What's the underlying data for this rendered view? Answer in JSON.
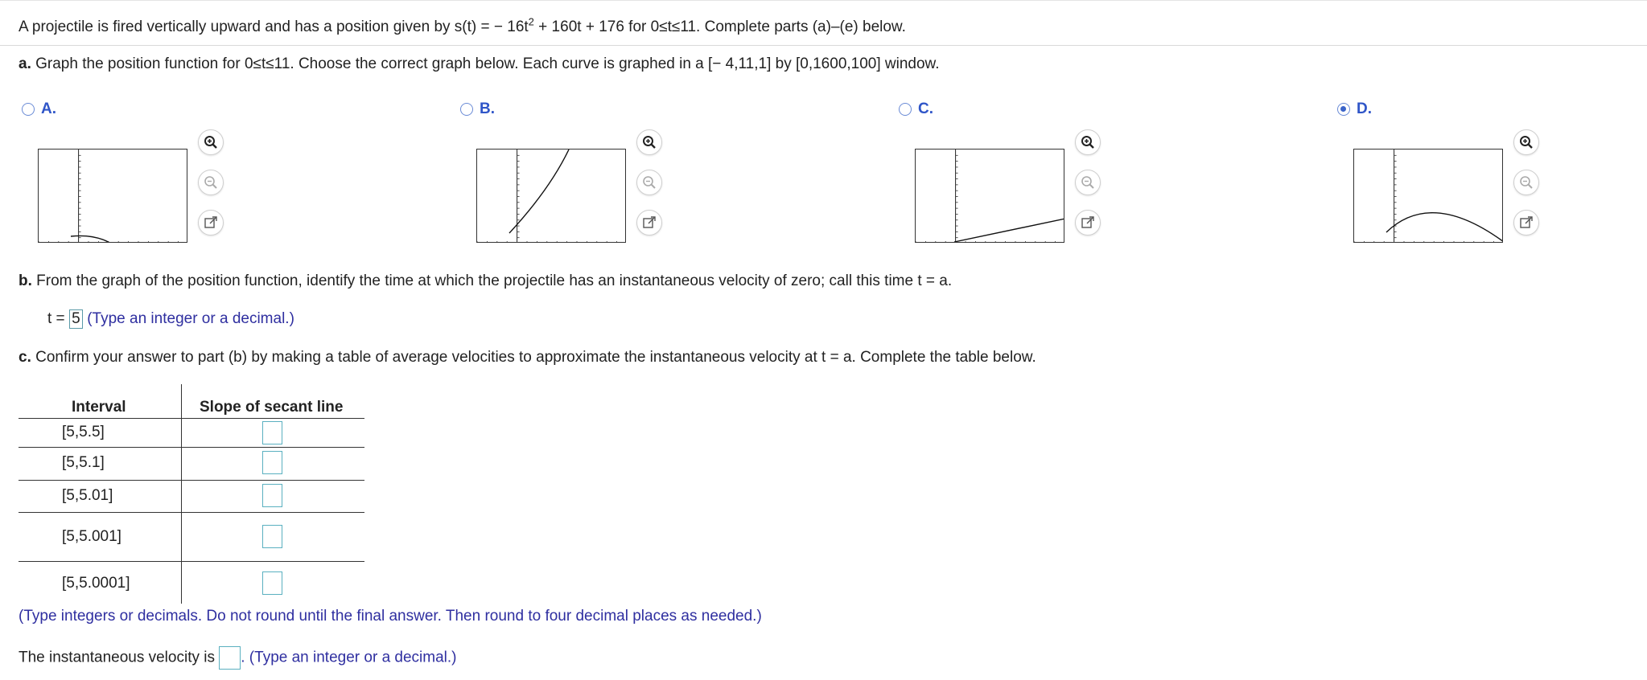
{
  "problem": {
    "intro_before": "A projectile is fired vertically upward and has a position given by s(t) = − 16t",
    "intro_sup": "2",
    "intro_after": " + 160t + 176 for 0≤t≤11. Complete parts (a)–(e) below."
  },
  "part_a": {
    "label": "a.",
    "text": " Graph the position function for 0≤t≤11. Choose the correct graph below. Each curve is graphed in a [− 4,11,1] by [0,1600,100] window.",
    "window": {
      "x_min": -4,
      "x_max": 11,
      "x_step": 1,
      "y_min": 0,
      "y_max": 1600,
      "y_step": 100
    },
    "options": [
      {
        "label": "A.",
        "selected": false
      },
      {
        "label": "B.",
        "selected": false
      },
      {
        "label": "C.",
        "selected": false
      },
      {
        "label": "D.",
        "selected": true
      }
    ]
  },
  "icons": {
    "zoom_in": "zoom-in-icon",
    "zoom_out": "zoom-out-icon",
    "open": "open-new-window-icon"
  },
  "part_b": {
    "label": "b.",
    "text": " From the graph of the position function, identify the time at which the projectile has an instantaneous velocity of zero; call this time t = a.",
    "answer_prefix": "t = ",
    "answer_value": "5",
    "hint": "(Type an integer or a decimal.)"
  },
  "part_c": {
    "label": "c.",
    "text": " Confirm your answer to part (b) by making a table of average velocities to approximate the instantaneous velocity at t = a. Complete the table below.",
    "table": {
      "headers": [
        "Interval",
        "Slope of secant line"
      ],
      "rows": [
        "[5,5.5]",
        "[5,5.1]",
        "[5,5.01]",
        "[5,5.001]",
        "[5,5.0001]"
      ]
    },
    "table_hint": "(Type integers or decimals. Do not round until the final answer. Then round to four decimal places as needed.)",
    "final_prefix": "The instantaneous velocity is ",
    "final_hint": ". (Type an integer or a decimal.)"
  },
  "colors": {
    "option_blue": "#2f55c8",
    "hint_blue": "#2f2fa0",
    "box_teal": "#5ab0c0"
  }
}
